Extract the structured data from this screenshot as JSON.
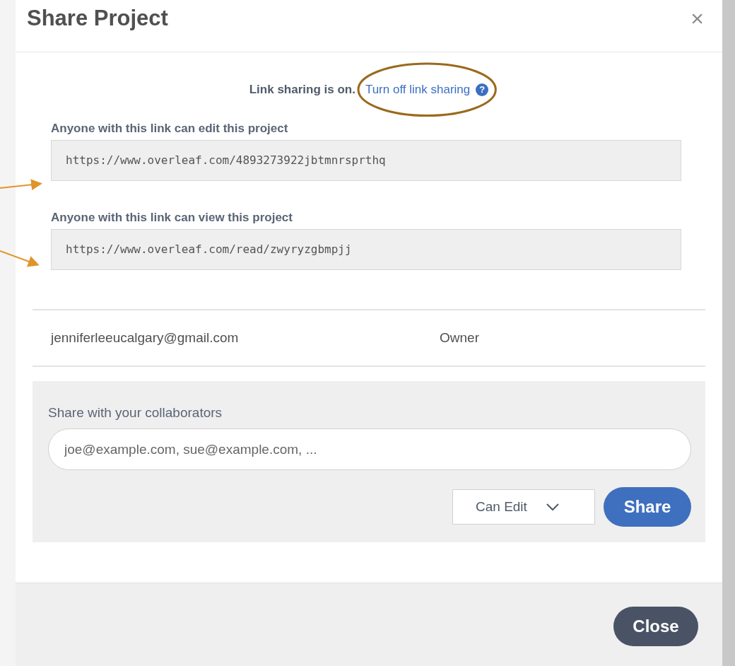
{
  "dialog": {
    "title": "Share Project",
    "close": "×"
  },
  "link_sharing": {
    "status": "Link sharing is on.",
    "action": "Turn off link sharing",
    "help": "?"
  },
  "links": [
    {
      "label": "Anyone with this link can edit this project",
      "url": "https://www.overleaf.com/4893273922jbtmnrsprthq"
    },
    {
      "label": "Anyone with this link can view this project",
      "url": "https://www.overleaf.com/read/zwyryzgbmpjj"
    }
  ],
  "members": [
    {
      "email": "jenniferleeucalgary@gmail.com",
      "role": "Owner"
    }
  ],
  "invite": {
    "label": "Share with your collaborators",
    "placeholder": "joe@example.com, sue@example.com, ...",
    "permission": "Can Edit",
    "button": "Share"
  },
  "footer": {
    "button": "Close"
  }
}
